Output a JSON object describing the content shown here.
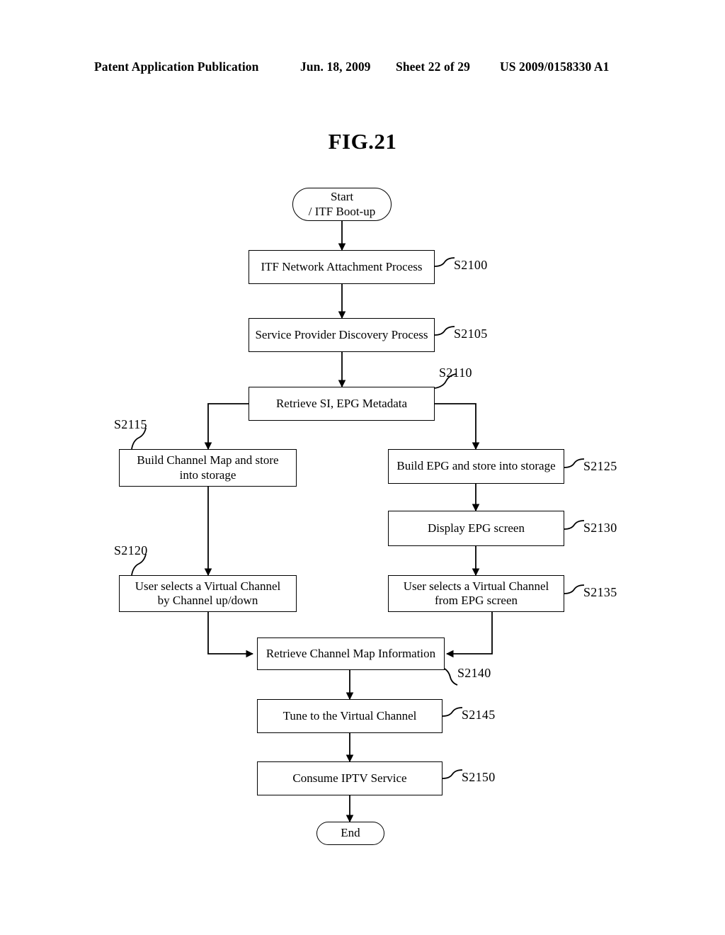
{
  "header": {
    "publication": "Patent Application Publication",
    "date": "Jun. 18, 2009",
    "sheet": "Sheet 22 of 29",
    "number": "US 2009/0158330 A1"
  },
  "figure": {
    "title": "FIG.21"
  },
  "flowchart": {
    "nodes": {
      "start": "Start\n/ ITF Boot-up",
      "start_line1": "Start",
      "start_line2": "/ ITF Boot-up",
      "s2100": "ITF Network Attachment Process",
      "s2105": "Service Provider Discovery Process",
      "s2110": "Retrieve SI, EPG Metadata",
      "s2115_line1": "Build Channel Map and store",
      "s2115_line2": "into storage",
      "s2125": "Build EPG and store  into storage",
      "s2130": "Display EPG screen",
      "s2120_line1": "User selects a Virtual Channel",
      "s2120_line2": "by Channel up/down",
      "s2135_line1": "User selects a Virtual Channel",
      "s2135_line2": "from EPG screen",
      "s2140": "Retrieve Channel Map Information",
      "s2145": "Tune to the Virtual Channel",
      "s2150": "Consume IPTV Service",
      "end": "End"
    },
    "step_refs": {
      "s2100": "S2100",
      "s2105": "S2105",
      "s2110": "S2110",
      "s2115": "S2115",
      "s2120": "S2120",
      "s2125": "S2125",
      "s2130": "S2130",
      "s2135": "S2135",
      "s2140": "S2140",
      "s2145": "S2145",
      "s2150": "S2150"
    }
  }
}
